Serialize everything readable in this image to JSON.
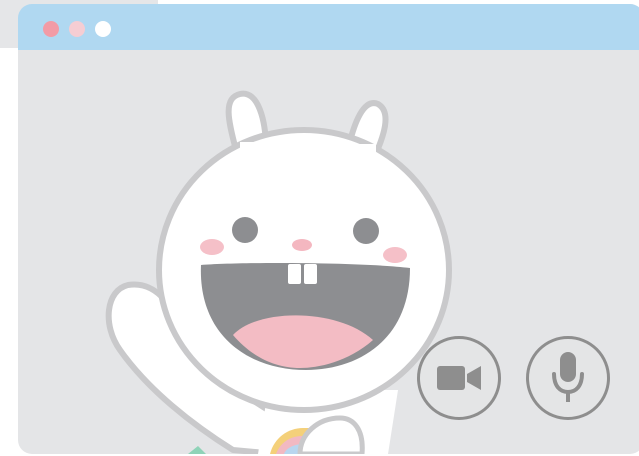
{
  "window": {
    "traffic_lights": [
      {
        "name": "close",
        "color": "#f29ba6"
      },
      {
        "name": "minimize",
        "color": "#f5cdd3"
      },
      {
        "name": "zoom",
        "color": "#ffffff"
      }
    ],
    "titlebar_color": "#b0d8f1",
    "background_color": "#e4e5e7"
  },
  "video": {
    "participant": "bunny-mascot-waving"
  },
  "controls": {
    "camera_icon": "video-camera-icon",
    "mic_icon": "microphone-icon",
    "icon_color": "#8e8e8e"
  }
}
